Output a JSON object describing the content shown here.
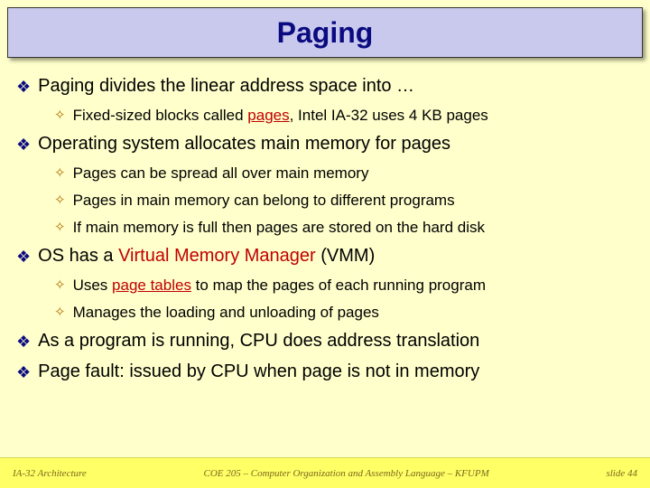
{
  "title": "Paging",
  "bullets": {
    "b1": {
      "pre": "Paging divides the linear address space into …"
    },
    "b1s1": {
      "pre": "Fixed-sized blocks called ",
      "red1": "pages",
      "post": ", Intel IA-32 uses 4 KB pages"
    },
    "b2": {
      "pre": "Operating system allocates main memory for pages"
    },
    "b2s1": {
      "pre": "Pages can be spread all over main memory"
    },
    "b2s2": {
      "pre": "Pages in main memory can belong to different programs"
    },
    "b2s3": {
      "pre": "If main memory is full then pages are stored on the hard disk"
    },
    "b3": {
      "pre": "OS has a ",
      "red1": "Virtual Memory Manager",
      "post": " (VMM)"
    },
    "b3s1": {
      "pre": "Uses ",
      "red1": "page tables",
      "post": " to map the pages of each running program"
    },
    "b3s2": {
      "pre": "Manages the loading and unloading of pages"
    },
    "b4": {
      "pre": "As a program is running, CPU does address translation"
    },
    "b5": {
      "pre": "Page fault: issued by CPU when page is not in memory"
    }
  },
  "footer": {
    "left": "IA-32 Architecture",
    "center": "COE 205 – Computer Organization and Assembly Language – KFUPM",
    "right": "slide 44"
  }
}
